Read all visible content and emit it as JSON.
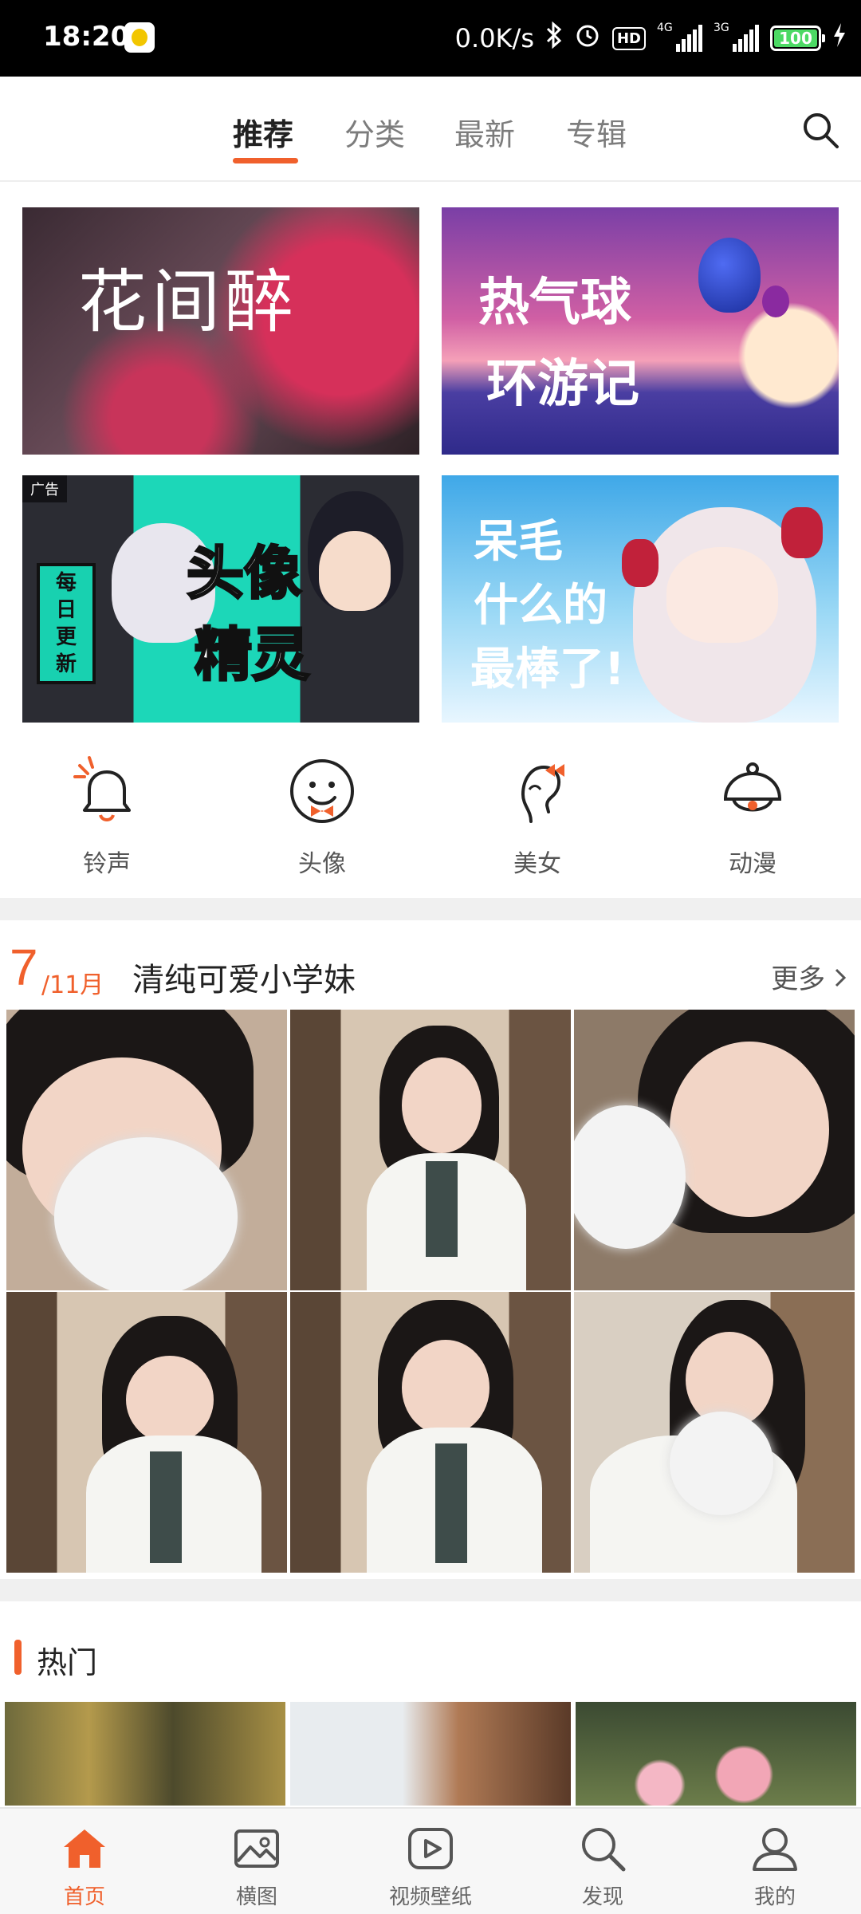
{
  "status_bar": {
    "time": "18:20",
    "net_speed": "0.0K/s",
    "hd": "HD",
    "net1": "4G",
    "net2": "3G",
    "battery": "100",
    "icons": [
      "app-notification-icon",
      "bluetooth-icon",
      "alarm-icon",
      "charging-icon"
    ]
  },
  "top_tabs": {
    "items": [
      {
        "label": "推荐",
        "active": true
      },
      {
        "label": "分类",
        "active": false
      },
      {
        "label": "最新",
        "active": false
      },
      {
        "label": "专辑",
        "active": false
      }
    ],
    "search_icon": "search-icon"
  },
  "banners": [
    {
      "text": "花间醉"
    },
    {
      "text_line1": "热气球",
      "text_line2": "环游记"
    },
    {
      "ad": "广告",
      "tag": "每日更新",
      "text_line1": "头像",
      "text_line2": "精灵"
    },
    {
      "text_line1": "呆毛",
      "text_line2": "什么的",
      "text_line3": "最棒了!"
    }
  ],
  "categories": [
    {
      "label": "铃声",
      "icon": "bell-icon"
    },
    {
      "label": "头像",
      "icon": "smiley-face-icon"
    },
    {
      "label": "美女",
      "icon": "woman-profile-icon"
    },
    {
      "label": "动漫",
      "icon": "anime-bell-icon"
    }
  ],
  "daily": {
    "day": "7",
    "month": "/11月",
    "title": "清纯可爱小学妹",
    "more": "更多",
    "more_icon": "chevron-right-icon"
  },
  "hot": {
    "title": "热门"
  },
  "bottom_nav": [
    {
      "label": "首页",
      "icon": "home-icon",
      "active": true
    },
    {
      "label": "横图",
      "icon": "image-icon",
      "active": false
    },
    {
      "label": "视频壁纸",
      "icon": "video-play-icon",
      "active": false
    },
    {
      "label": "发现",
      "icon": "discover-search-icon",
      "active": false
    },
    {
      "label": "我的",
      "icon": "profile-icon",
      "active": false
    }
  ],
  "colors": {
    "accent": "#f0602c",
    "status_bar_bg": "#000000",
    "section_divider": "#f0f0f0"
  }
}
